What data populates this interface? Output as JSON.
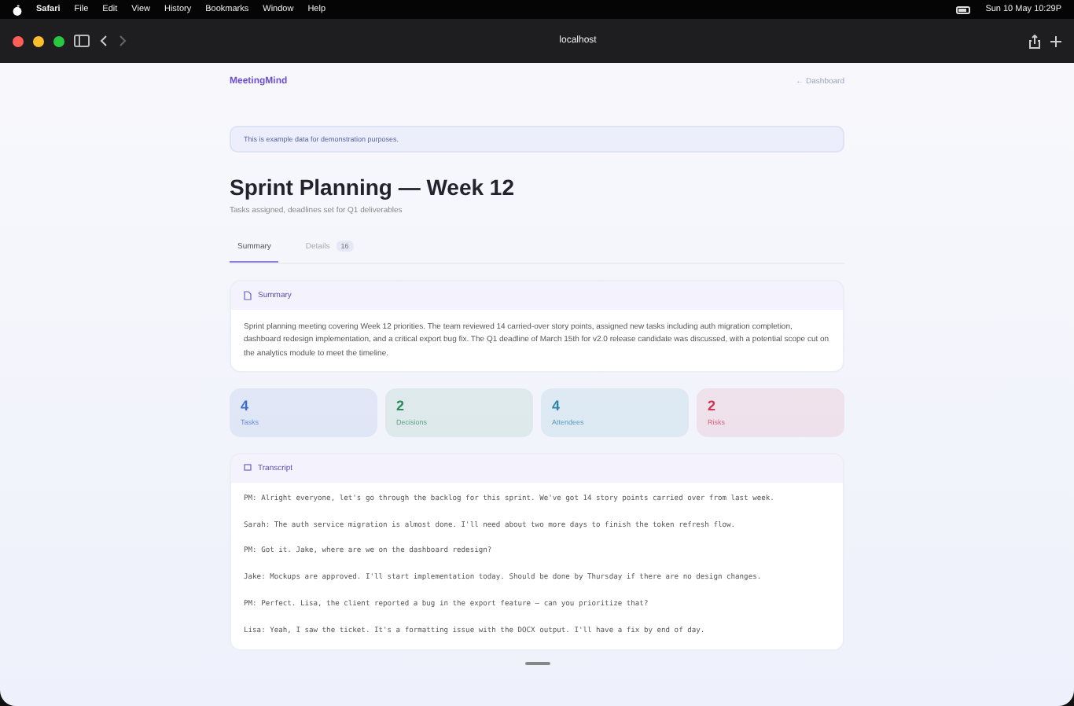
{
  "menu_bar": {
    "app": "Safari",
    "items": [
      "File",
      "Edit",
      "View",
      "History",
      "Bookmarks",
      "Window",
      "Help"
    ],
    "clock": "Sun 10 May 10:29P"
  },
  "browser": {
    "address": "localhost"
  },
  "header": {
    "brand": "MeetingMind",
    "back_link": "← Dashboard"
  },
  "notice": "This is example data for demonstration purposes.",
  "title": "Sprint Planning — Week 12",
  "subtitle": "Tasks assigned, deadlines set for Q1 deliverables",
  "tabs": [
    {
      "label": "Summary",
      "selected": true
    },
    {
      "label": "Details",
      "count": "16",
      "selected": false
    }
  ],
  "summary": {
    "heading": "Summary",
    "text": "Sprint planning meeting covering Week 12 priorities. The team reviewed 14 carried-over story points, assigned new tasks including auth migration completion, dashboard redesign implementation, and a critical export bug fix. The Q1 deadline of March 15th for v2.0 release candidate was discussed, with a potential scope cut on the analytics module to meet the timeline."
  },
  "stats": [
    {
      "value": "4",
      "label": "Tasks",
      "color": "#3d6fce"
    },
    {
      "value": "2",
      "label": "Decisions",
      "color": "#2e8b5e"
    },
    {
      "value": "4",
      "label": "Attendees",
      "color": "#2a86a6"
    },
    {
      "value": "2",
      "label": "Risks",
      "color": "#cf3656"
    }
  ],
  "transcript": {
    "heading": "Transcript",
    "lines": [
      "PM: Alright everyone, let's go through the backlog for this sprint. We've got 14 story points carried over from last week.",
      "Sarah: The auth service migration is almost done. I'll need about two more days to finish the token refresh flow.",
      "PM: Got it. Jake, where are we on the dashboard redesign?",
      "Jake: Mockups are approved. I'll start implementation today. Should be done by Thursday if there are no design changes.",
      "PM: Perfect. Lisa, the client reported a bug in the export feature — can you prioritize that?",
      "Lisa: Yeah, I saw the ticket. It's a formatting issue with the DOCX output. I'll have a fix by end of day."
    ]
  }
}
